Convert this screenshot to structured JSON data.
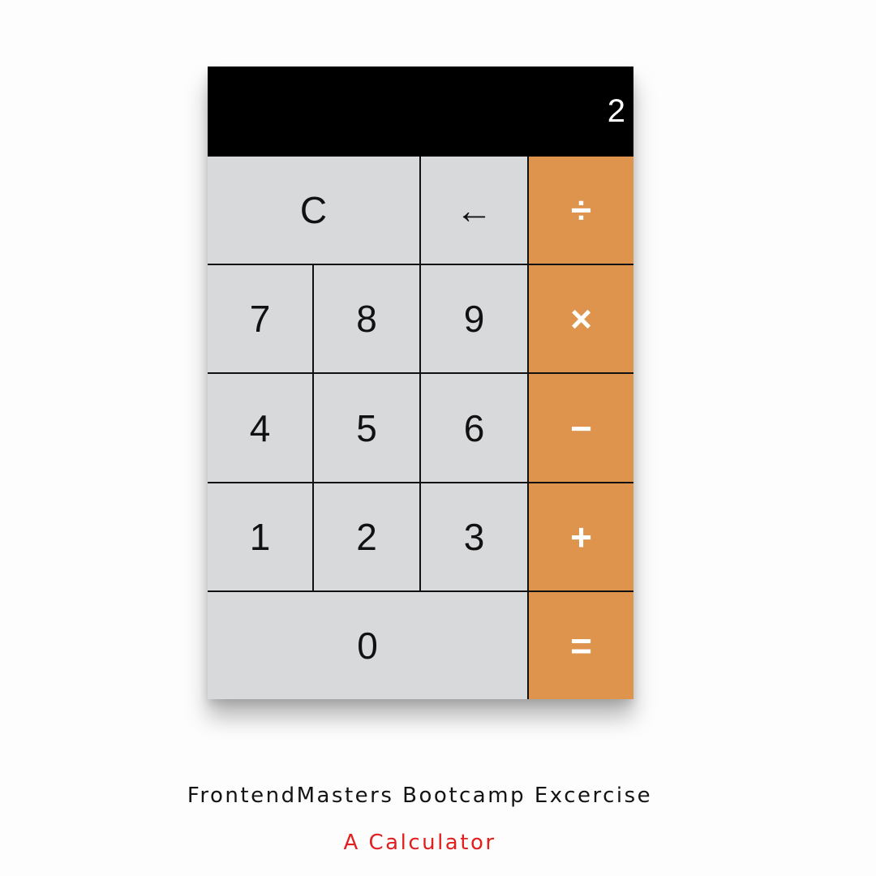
{
  "calculator": {
    "display": "2",
    "buttons": {
      "clear": "C",
      "backspace": "←",
      "divide": "÷",
      "seven": "7",
      "eight": "8",
      "nine": "9",
      "multiply": "×",
      "four": "4",
      "five": "5",
      "six": "6",
      "minus": "−",
      "one": "1",
      "two": "2",
      "three": "3",
      "plus": "+",
      "zero": "0",
      "equals": "="
    }
  },
  "caption": {
    "title": "FrontendMasters Bootcamp Excercise",
    "subtitle": "A Calculator"
  },
  "colors": {
    "display_bg": "#000000",
    "button_bg": "#d8d9db",
    "operator_bg": "#de944d",
    "subtitle_text": "#e21f1f"
  }
}
